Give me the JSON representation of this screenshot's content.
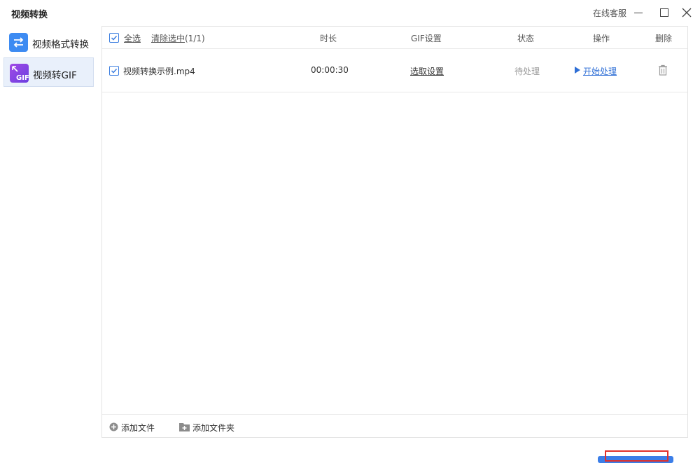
{
  "window": {
    "title": "视频转换",
    "support_label": "在线客服",
    "controls": [
      "minimize-icon",
      "maximize-icon",
      "close-icon"
    ]
  },
  "sidebar": {
    "items": [
      {
        "label": "视频格式转换",
        "icon": "convert-arrows-icon",
        "active": false,
        "icon_color": "#3d8bf2"
      },
      {
        "label": "视频转GIF",
        "icon": "gif-icon",
        "active": true,
        "icon_color": "#8a45e6"
      }
    ]
  },
  "table": {
    "select_all_label": "全选",
    "select_all_checked": true,
    "clear_selected_label": "清除选中",
    "selection_count": "(1/1)",
    "columns": [
      "时长",
      "GIF设置",
      "状态",
      "操作",
      "删除"
    ],
    "rows": [
      {
        "checked": true,
        "filename": "视频转换示例.mp4",
        "duration": "00:00:30",
        "gif_setting": "选取设置",
        "status": "待处理",
        "action": "开始处理"
      }
    ]
  },
  "footer": {
    "add_file_label": "添加文件",
    "add_folder_label": "添加文件夹"
  },
  "colors": {
    "accent": "#3b7ee8",
    "link": "#2f6fd6",
    "highlight": "#e0302b"
  }
}
